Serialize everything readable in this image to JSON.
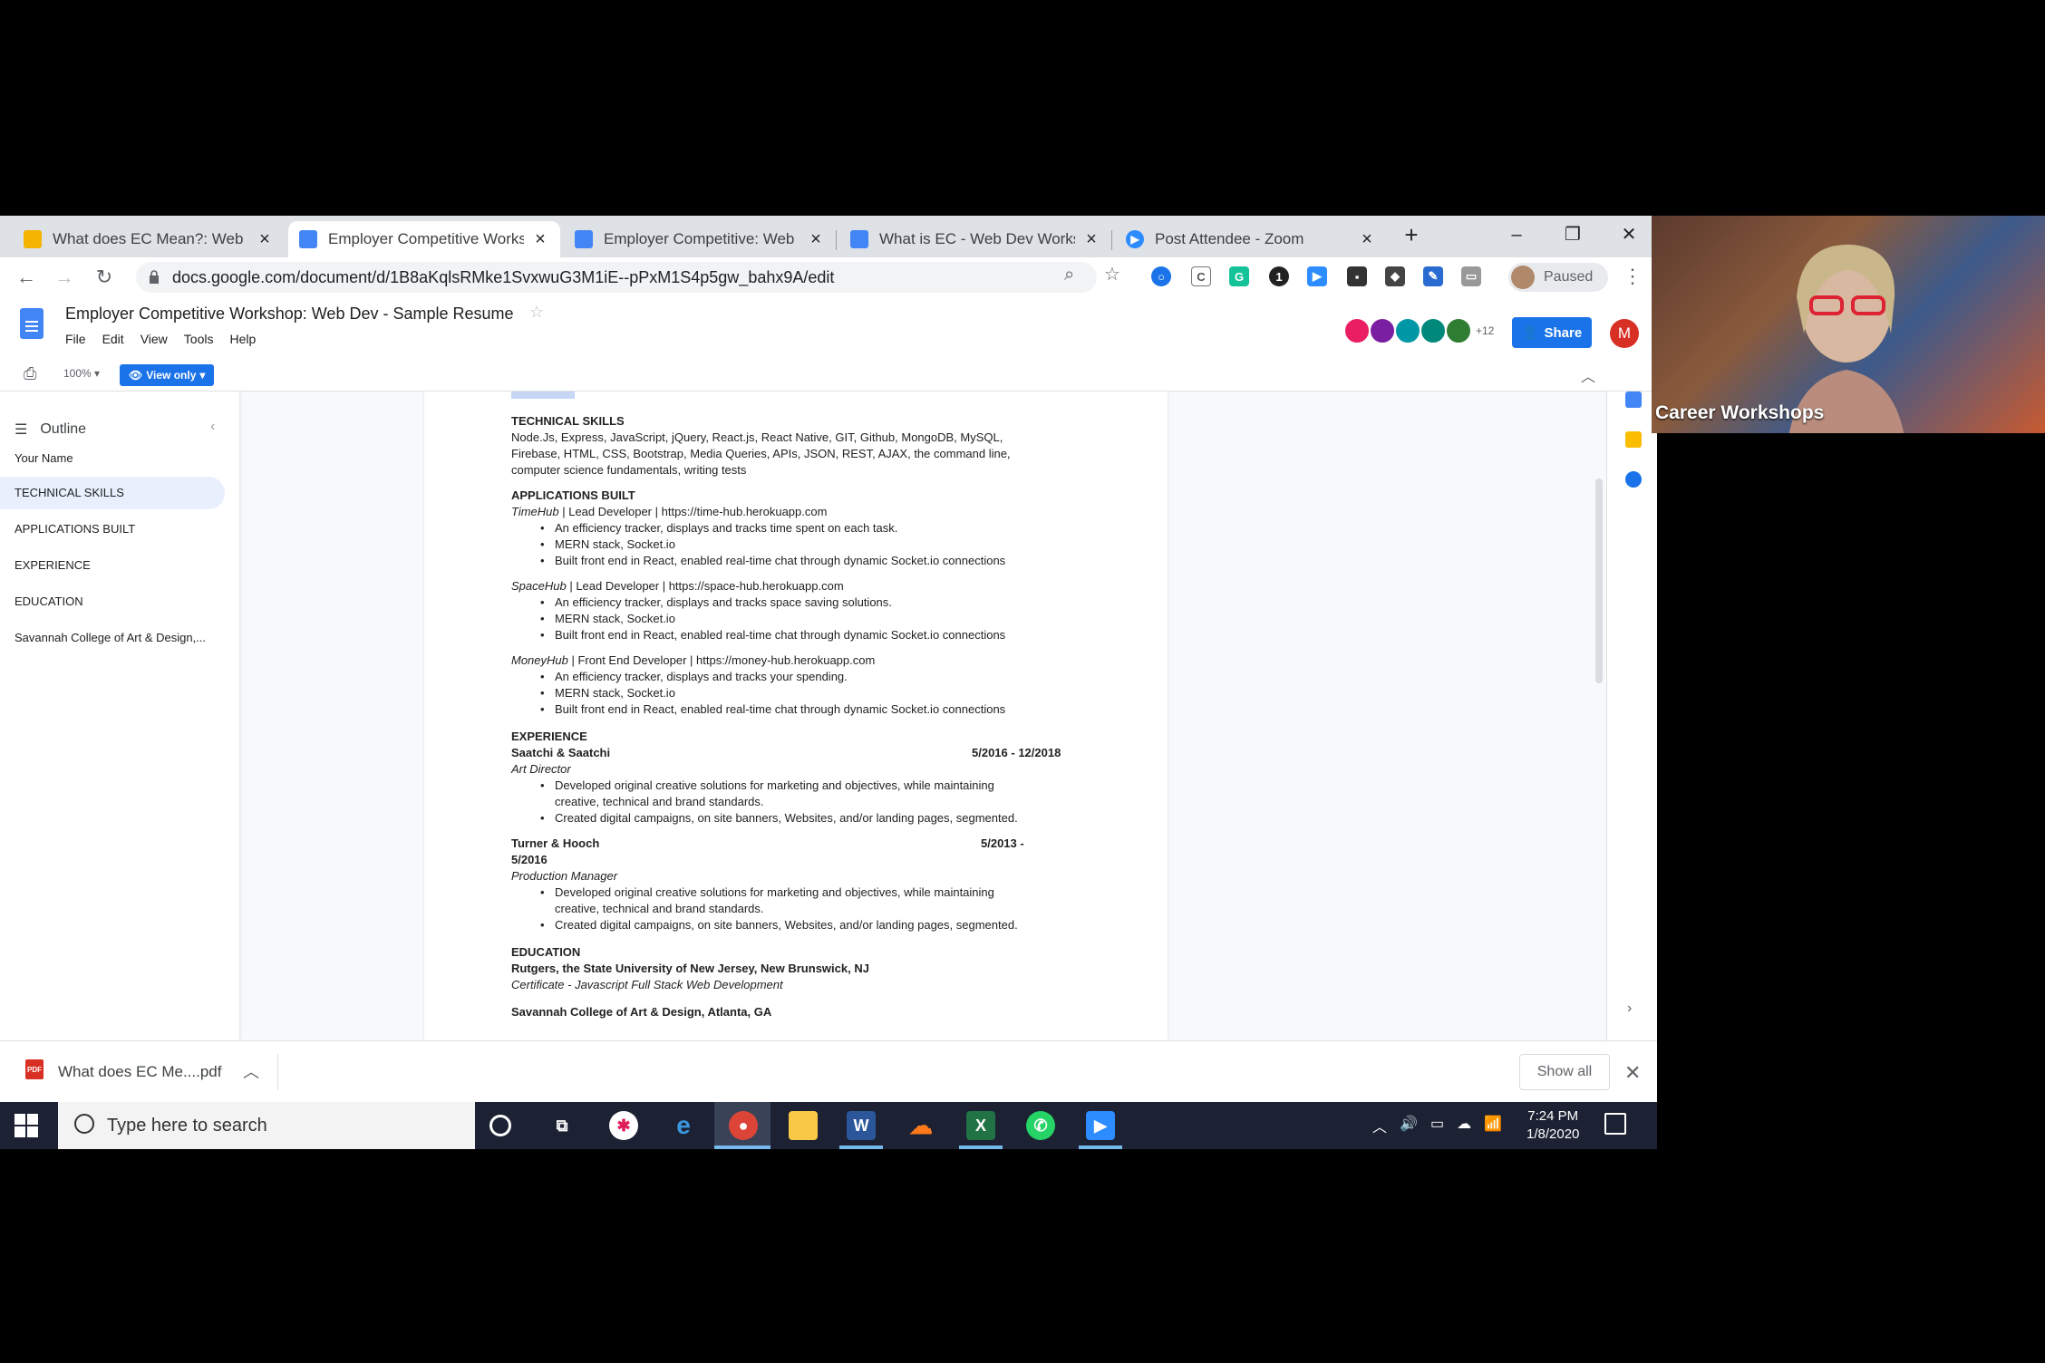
{
  "browser": {
    "tabs": [
      {
        "title": "What does EC Mean?: Web De",
        "icon": "slides-icon",
        "color": "#f4b400"
      },
      {
        "title": "Employer Competitive Worksh",
        "icon": "docs-icon",
        "color": "#4285f4",
        "active": true
      },
      {
        "title": "Employer Competitive: Web De",
        "icon": "docs-icon",
        "color": "#4285f4"
      },
      {
        "title": "What is EC - Web Dev Worksh",
        "icon": "docs-icon",
        "color": "#4285f4"
      },
      {
        "title": "Post Attendee - Zoom",
        "icon": "zoom-icon",
        "color": "#2d8cff"
      }
    ],
    "url": "docs.google.com/document/d/1B8aKqlsRMke1SvxwuG3M1iE--pPxM1S4p5gw_bahx9A/edit",
    "profile_status": "Paused"
  },
  "docs": {
    "title": "Employer Competitive Workshop: Web Dev - Sample Resume",
    "menu": [
      "File",
      "Edit",
      "View",
      "Tools",
      "Help"
    ],
    "collaborators_more": "+12",
    "share_label": "Share",
    "account_initial": "M",
    "zoom": "100%",
    "mode_label": "View only",
    "outline": {
      "heading": "Outline",
      "items": [
        "Your Name",
        "TECHNICAL SKILLS",
        "APPLICATIONS BUILT",
        "EXPERIENCE",
        "EDUCATION",
        "Savannah College of Art & Design,..."
      ],
      "active_index": 1
    },
    "resume": {
      "skills_heading": "TECHNICAL SKILLS",
      "skills_lines": [
        "Node.Js, Express, JavaScript, jQuery, React.js, React Native, GIT, Github, MongoDB, MySQL,",
        "Firebase, HTML, CSS, Bootstrap, Media Queries, APIs, JSON, REST, AJAX, the command line,",
        "computer science fundamentals, writing tests"
      ],
      "apps_heading": "APPLICATIONS BUILT",
      "apps": [
        {
          "name": "TimeHub",
          "role": " | Lead Developer |  https://time-hub.herokuapp.com",
          "bullets": [
            "An efficiency tracker, displays and tracks time spent on each task.",
            "MERN stack, Socket.io",
            "Built front end in React, enabled real-time chat through dynamic Socket.io connections"
          ]
        },
        {
          "name": "SpaceHub",
          "role": " | Lead Developer |  https://space-hub.herokuapp.com",
          "bullets": [
            "An efficiency tracker, displays and tracks space saving solutions.",
            "MERN stack, Socket.io",
            "Built front end in React, enabled real-time chat through dynamic Socket.io connections"
          ]
        },
        {
          "name": "MoneyHub",
          "role": " | Front End Developer |  https://money-hub.herokuapp.com",
          "bullets": [
            "An efficiency tracker, displays and tracks your spending.",
            "MERN stack, Socket.io",
            "Built front end in React, enabled real-time chat through dynamic Socket.io connections"
          ]
        }
      ],
      "exp_heading": "EXPERIENCE",
      "jobs": [
        {
          "company": "Saatchi & Saatchi",
          "dates": "5/2016 - 12/2018",
          "dates2": "",
          "title": "Art Director",
          "bullets": [
            "Developed original creative solutions for marketing and objectives, while maintaining",
            "creative, technical and brand standards.",
            "Created digital campaigns, on site banners, Websites, and/or landing pages, segmented."
          ]
        },
        {
          "company": "Turner & Hooch",
          "dates": "5/2013 -",
          "dates2": "5/2016",
          "title": "Production Manager",
          "bullets": [
            "Developed original creative solutions for marketing and objectives, while maintaining",
            "creative, technical and brand standards.",
            "Created digital campaigns, on site banners, Websites, and/or landing pages, segmented."
          ]
        }
      ],
      "edu_heading": "EDUCATION",
      "school1": "Rutgers, the State University of New Jersey, New Brunswick, NJ",
      "cert": "Certificate - Javascript Full Stack Web Development",
      "school2": "Savannah College of Art & Design, Atlanta, GA"
    }
  },
  "download": {
    "file": "What does EC Me....pdf",
    "type": "PDF",
    "show_all": "Show all"
  },
  "taskbar": {
    "search_placeholder": "Type here to search",
    "time": "7:24 PM",
    "date": "1/8/2020"
  },
  "webcam": {
    "name": "Career Workshops"
  }
}
